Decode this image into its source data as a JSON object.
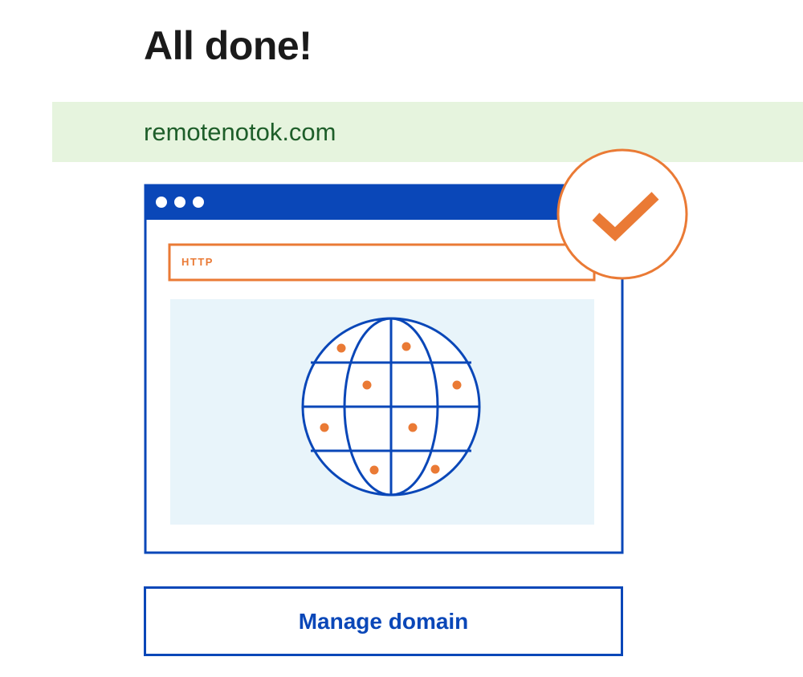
{
  "page": {
    "title": "All done!"
  },
  "domain_banner": {
    "domain": "remotenotok.com"
  },
  "illustration": {
    "address_bar_label": "HTTP",
    "status_icon": "checkmark-icon",
    "content_icon": "globe-icon"
  },
  "actions": {
    "manage_label": "Manage domain"
  },
  "colors": {
    "brand_blue": "#0a47b8",
    "accent_orange": "#ea7a35",
    "banner_green": "#e6f4de",
    "domain_text_green": "#1e5e2a",
    "content_light_blue": "#e8f4fa"
  }
}
